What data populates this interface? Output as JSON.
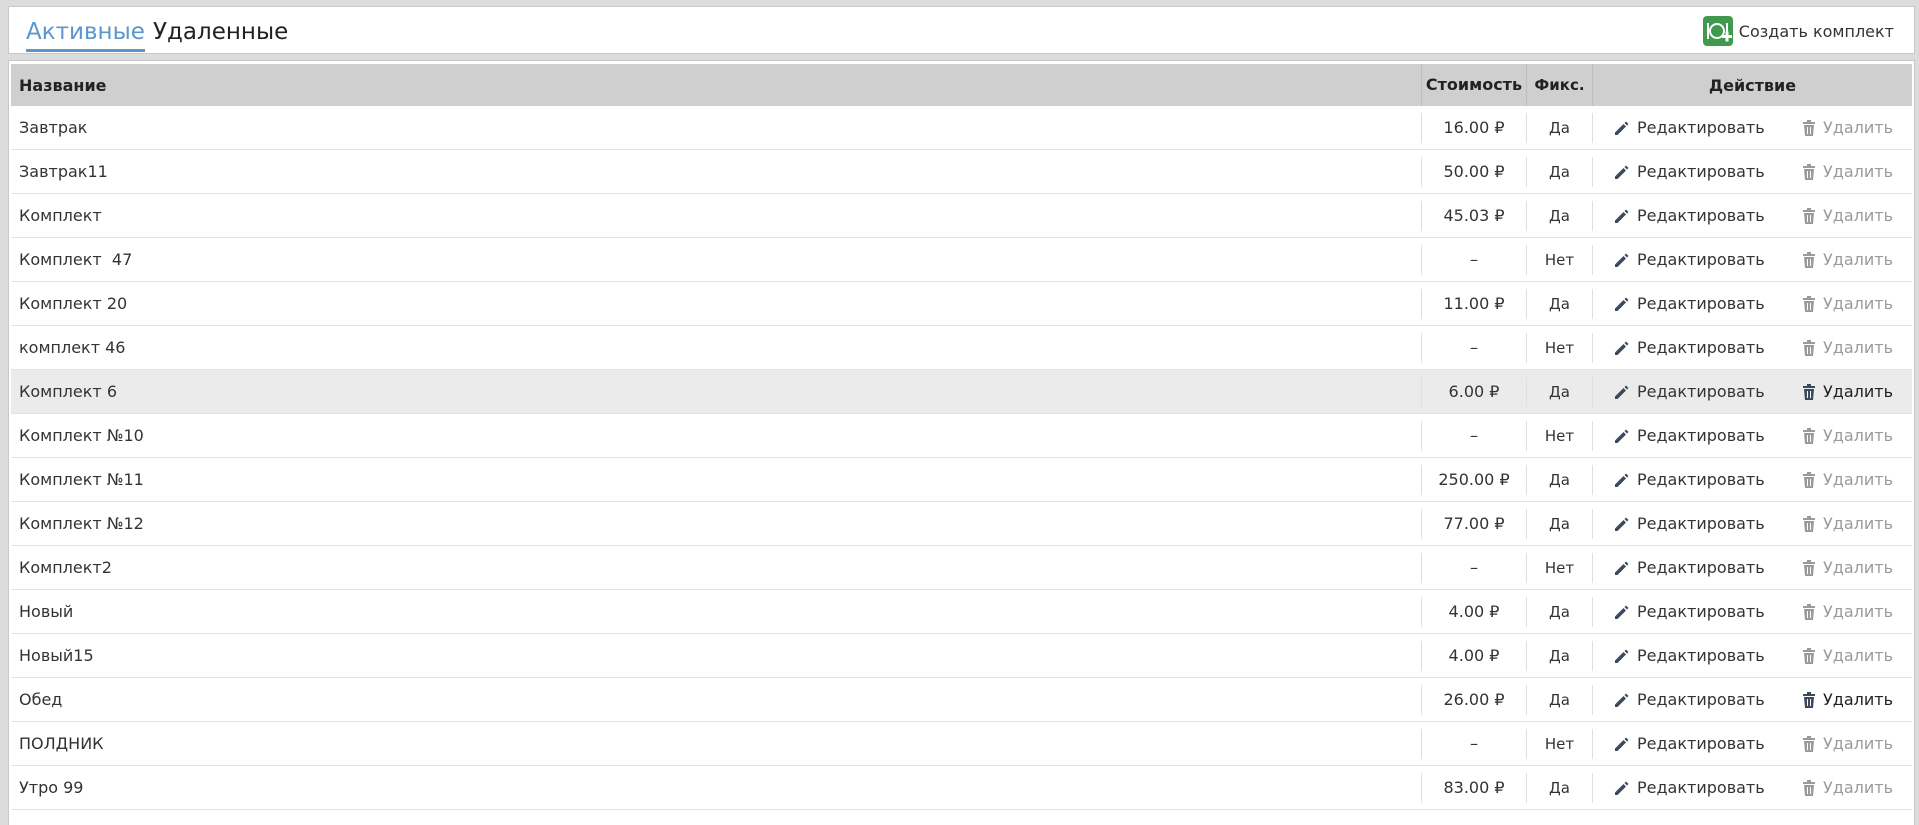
{
  "tabs": {
    "active": "Активные",
    "deleted": "Удаленные"
  },
  "create_label": "Создать комплект",
  "columns": {
    "name": "Название",
    "cost": "Стоимость",
    "fixed": "Фикс.",
    "action": "Действие"
  },
  "actions": {
    "edit": "Редактировать",
    "delete": "Удалить"
  },
  "rows": [
    {
      "name": "Завтрак",
      "cost": "16.00 ₽",
      "fixed": "Да"
    },
    {
      "name": "Завтрак11",
      "cost": "50.00 ₽",
      "fixed": "Да"
    },
    {
      "name": "Комплект",
      "cost": "45.03 ₽",
      "fixed": "Да"
    },
    {
      "name": "Комплект  47",
      "cost": "–",
      "fixed": "Нет"
    },
    {
      "name": "Комплект 20",
      "cost": "11.00 ₽",
      "fixed": "Да"
    },
    {
      "name": "комплект 46",
      "cost": "–",
      "fixed": "Нет"
    },
    {
      "name": "Комплект 6",
      "cost": "6.00 ₽",
      "fixed": "Да"
    },
    {
      "name": "Комплект №10",
      "cost": "–",
      "fixed": "Нет"
    },
    {
      "name": "Комплект №11",
      "cost": "250.00 ₽",
      "fixed": "Да"
    },
    {
      "name": "Комплект №12",
      "cost": "77.00 ₽",
      "fixed": "Да"
    },
    {
      "name": "Комплект2",
      "cost": "–",
      "fixed": "Нет"
    },
    {
      "name": "Новый",
      "cost": "4.00 ₽",
      "fixed": "Да"
    },
    {
      "name": "Новый15",
      "cost": "4.00 ₽",
      "fixed": "Да"
    },
    {
      "name": "Обед",
      "cost": "26.00 ₽",
      "fixed": "Да"
    },
    {
      "name": "ПОЛДНИК",
      "cost": "–",
      "fixed": "Нет"
    },
    {
      "name": "Утро 99",
      "cost": "83.00 ₽",
      "fixed": "Да"
    }
  ],
  "colors": {
    "accent": "#5a96cf",
    "create_icon": "#3f9a4e",
    "header_bg": "#cfcfcf",
    "row_highlight": "#ebebeb"
  }
}
